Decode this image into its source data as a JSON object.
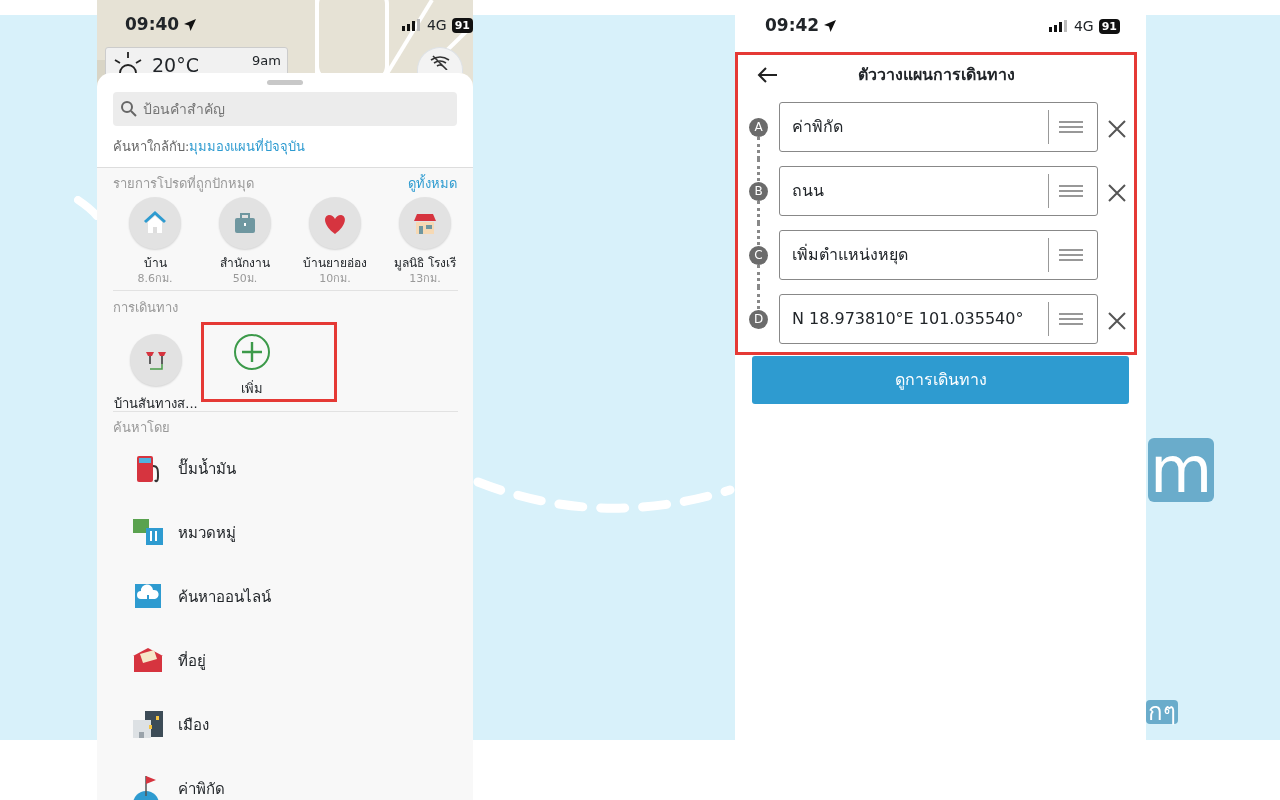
{
  "background_text": [
    {
      "text": "m"
    },
    {
      "text": "กๆ"
    }
  ],
  "left_screen": {
    "status_bar": {
      "time": "09:40",
      "network": "4G",
      "battery": "91"
    },
    "weather": {
      "temperature": "20°C",
      "time": "9am"
    },
    "search": {
      "placeholder": "ป้อนคำสำคัญ"
    },
    "near": {
      "label": "ค้นหาใกล้กับ:",
      "link": "มุมมองแผนที่ปัจจุบัน"
    },
    "favorites": {
      "title": "รายการโปรดที่ถูกปักหมุด",
      "view_all": "ดูทั้งหมด",
      "items": [
        {
          "kind": "home",
          "name": "บ้าน",
          "distance": "8.6กม."
        },
        {
          "kind": "work",
          "name": "สำนักงาน",
          "distance": "50ม."
        },
        {
          "kind": "heart",
          "name": "บ้านยายอ่อง",
          "distance": "10กม."
        },
        {
          "kind": "shop",
          "name": "มูลนิธิ โรงเรี",
          "distance": "13กม."
        }
      ]
    },
    "travel": {
      "title": "การเดินทาง",
      "items": [
        {
          "kind": "route",
          "label": "บ้านสันทางส...",
          "highlighted": false
        },
        {
          "kind": "add",
          "label": "เพิ่ม",
          "highlighted": true
        }
      ]
    },
    "search_by": {
      "title": "ค้นหาโดย",
      "items": [
        {
          "kind": "fuel",
          "label": "ปั๊มน้ำมัน"
        },
        {
          "kind": "category",
          "label": "หมวดหมู่"
        },
        {
          "kind": "cloud",
          "label": "ค้นหาออนไลน์"
        },
        {
          "kind": "address",
          "label": "ที่อยู่"
        },
        {
          "kind": "city",
          "label": "เมือง"
        },
        {
          "kind": "coordinates",
          "label": "ค่าพิกัด"
        }
      ]
    }
  },
  "right_screen": {
    "status_bar": {
      "time": "09:42",
      "network": "4G",
      "battery": "91"
    },
    "highlighted": true,
    "title": "ตัววางแผนการเดินทาง",
    "stops": [
      {
        "letter": "A",
        "value": "ค่าพิกัด",
        "removable": true
      },
      {
        "letter": "B",
        "value": "ถนน",
        "removable": true
      },
      {
        "letter": "C",
        "value": "เพิ่มตำแหน่งหยุด",
        "removable": false
      },
      {
        "letter": "D",
        "value": "N 18.973810°E 101.035540°",
        "removable": true
      }
    ],
    "button": "ดูการเดินทาง"
  }
}
